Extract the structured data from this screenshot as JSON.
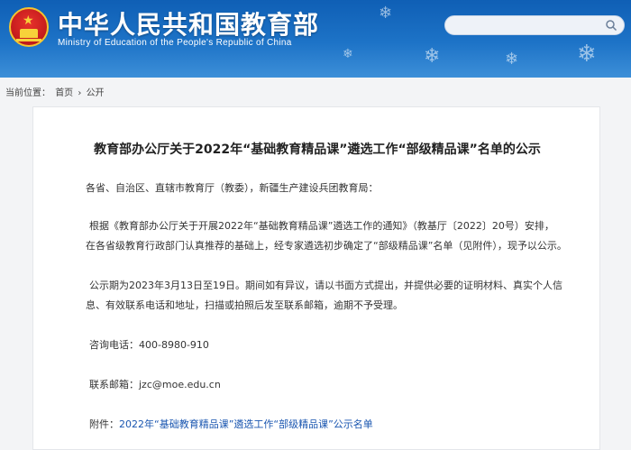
{
  "header": {
    "title": "中华人民共和国教育部",
    "subtitle": "Ministry of Education of the People's Republic of China",
    "search_placeholder": ""
  },
  "breadcrumb": {
    "prefix": "当前位置：",
    "home": "首页",
    "separator": "›",
    "current": "公开"
  },
  "article": {
    "title": "教育部办公厅关于2022年“基础教育精品课”遴选工作“部级精品课”名单的公示",
    "salutation": "各省、自治区、直辖市教育厅（教委），新疆生产建设兵团教育局：",
    "para1_line1": "根据《教育部办公厅关于开展2022年“基础教育精品课”遴选工作的通知》（教基厅〔2022〕20号）安排，",
    "para1_line2": "在各省级教育行政部门认真推荐的基础上，经专家遴选初步确定了“部级精品课”名单（见附件），现予以公示。",
    "para2_line1": "公示期为2023年3月13日至19日。期间如有异议，请以书面方式提出，并提供必要的证明材料、真实个人信",
    "para2_line2": "息、有效联系电话和地址，扫描或拍照后发至联系邮箱，逾期不予受理。",
    "phone_label": "咨询电话：",
    "phone": "400-8980-910",
    "email_label": "联系邮箱：",
    "email": "jzc@moe.edu.cn",
    "attachment_label": "附件：",
    "attachment_link": "2022年“基础教育精品课”遴选工作“部级精品课”公示名单"
  },
  "colors": {
    "header_blue": "#1d73c7",
    "link_blue": "#1a56b0",
    "emblem_red": "#c81e1e",
    "emblem_gold": "#f4c430"
  }
}
